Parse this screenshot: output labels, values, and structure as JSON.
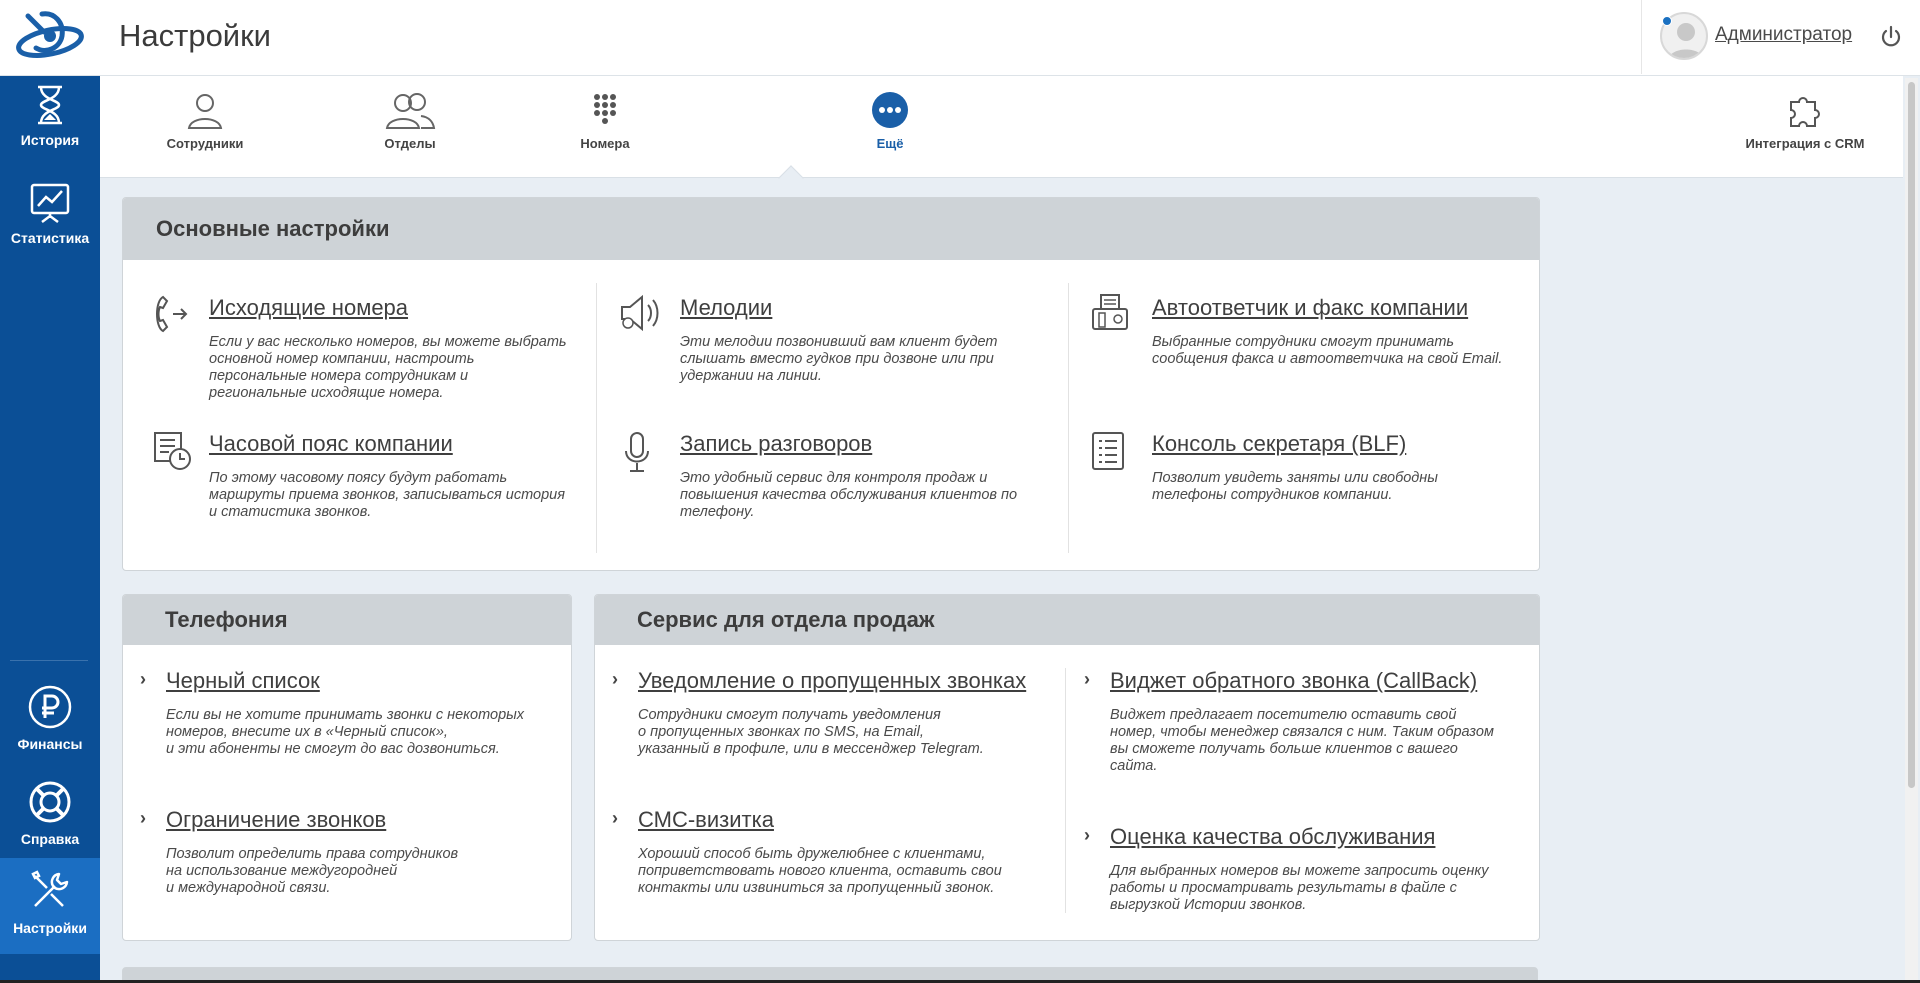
{
  "header": {
    "title": "Настройки",
    "user": "Администратор"
  },
  "sidebar": {
    "items": [
      {
        "label": "История",
        "icon": "hourglass-icon"
      },
      {
        "label": "Статистика",
        "icon": "chart-icon"
      },
      {
        "label": "Финансы",
        "icon": "ruble-icon"
      },
      {
        "label": "Справка",
        "icon": "lifebuoy-icon"
      },
      {
        "label": "Настройки",
        "icon": "tools-icon",
        "active": true
      }
    ]
  },
  "tabs": [
    {
      "label": "Сотрудники",
      "icon": "person-icon"
    },
    {
      "label": "Отделы",
      "icon": "people-icon"
    },
    {
      "label": "Номера",
      "icon": "keypad-icon"
    },
    {
      "label": "Ещё",
      "icon": "more-icon",
      "active": true
    },
    {
      "label": "Интеграция с CRM",
      "icon": "puzzle-icon"
    }
  ],
  "main_settings": {
    "title": "Основные настройки",
    "items": [
      {
        "title": "Исходящие номера",
        "desc": "Если у вас несколько номеров, вы можете выбрать\nосновной номер компании, настроить\nперсональные номера сотрудникам и\nрегиональные исходящие номера.",
        "icon": "outgoing-call-icon"
      },
      {
        "title": "Мелодии",
        "desc": "Эти мелодии позвонивший вам клиент будет\nслышать вместо гудков при дозвоне или при\nудержании на линии.",
        "icon": "speaker-icon"
      },
      {
        "title": "Автоответчик и факс компании",
        "desc": "Выбранные сотрудники смогут принимать\nсообщения факса и автоответчика на свой Email.",
        "icon": "fax-icon"
      },
      {
        "title": "Часовой пояс компании",
        "desc": "По этому часовому поясу будут работать\nмаршруты приема звонков, записываться история\nи статистика звонков.",
        "icon": "timezone-icon"
      },
      {
        "title": "Запись разговоров",
        "desc": "Это удобный сервис для контроля продаж и\nповышения качества обслуживания клиентов по\nтелефону.",
        "icon": "microphone-icon"
      },
      {
        "title": "Консоль секретаря (BLF)",
        "desc": "Позволит увидеть заняты или свободны\nтелефоны сотрудников компании.",
        "icon": "console-icon"
      }
    ]
  },
  "telephony": {
    "title": "Телефония",
    "items": [
      {
        "title": "Черный список",
        "desc": "Если вы не хотите принимать звонки с некоторых\nномеров, внесите их в «Черный список»,\nи эти абоненты не смогут до вас дозвониться."
      },
      {
        "title": "Ограничение звонков",
        "desc": "Позволит определить права сотрудников\nна использование междугородней\nи международной связи."
      }
    ]
  },
  "sales": {
    "title": "Сервис для отдела продаж",
    "items": [
      {
        "title": "Уведомление о пропущенных звонках",
        "desc": "Сотрудники смогут получать уведомления\nо пропущенных звонках по SMS, на Email,\nуказанный в профиле, или в мессенджер Telegram."
      },
      {
        "title": "Виджет обратного звонка (CallBack)",
        "desc": "Виджет предлагает посетителю оставить свой\nномер, чтобы менеджер связался с ним. Таким образом\nвы сможете получать больше клиентов с вашего\nсайта."
      },
      {
        "title": "СМС-визитка",
        "desc": "Хороший способ быть дружелюбнее с клиентами,\nпоприветствовать нового клиента, оставить свои\nконтакты или извиниться за пропущенный звонок."
      },
      {
        "title": "Оценка качества обслуживания",
        "desc": "Для выбранных номеров вы можете запросить оценку\nработы и просматривать результаты в файле с\nвыгрузкой Истории звонков."
      }
    ]
  },
  "colors": {
    "sidebar": "#0b4f96",
    "sidebar_active": "#1b6ec2",
    "accent": "#1a5fa8",
    "panel_header": "#ced3d7"
  }
}
